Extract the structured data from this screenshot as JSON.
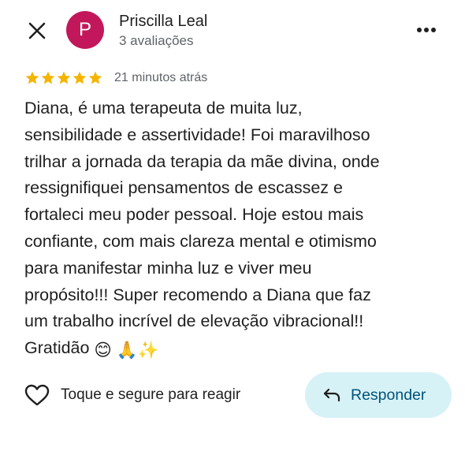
{
  "header": {
    "close_icon": "close-icon",
    "avatar_letter": "P",
    "avatar_color": "#c2185b",
    "user_name": "Priscilla Leal",
    "review_count": "3 avaliações",
    "more_icon": "more-vert-icon"
  },
  "review": {
    "rating": 5,
    "rating_max": 5,
    "star_color": "#f4b400",
    "time": "21 minutos atrás",
    "text": "Diana, é uma terapeuta de muita luz,\nsensibilidade e assertividade! Foi maravilhoso\ntrilhar a jornada da terapia da mãe divina, onde\nressignifiquei pensamentos de escassez e\nfortaleci meu poder pessoal. Hoje estou mais\nconfiante, com mais clareza mental e otimismo\npara manifestar minha luz e viver meu\npropósito!!! Super recomendo a Diana que faz\num trabalho incrível de elevação vibracional!!\nGratidão",
    "emojis": [
      "😊",
      "🙏",
      "✨"
    ]
  },
  "actions": {
    "react_icon": "heart-outline-icon",
    "react_label": "Toque e segure para reagir",
    "reply_icon": "reply-arrow-icon",
    "reply_label": "Responder",
    "reply_bg": "#d7f2f6",
    "reply_text_color": "#00527a"
  }
}
